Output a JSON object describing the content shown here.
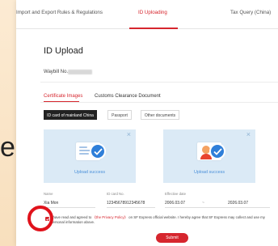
{
  "background": {
    "fragment": "e"
  },
  "tabs": [
    {
      "label": "Import and Export Rules & Regulations"
    },
    {
      "label": "ID Uploading"
    },
    {
      "label": "Tax Query (China)"
    }
  ],
  "page_title": "ID Upload",
  "waybill": {
    "label": "Waybill No."
  },
  "subtabs": [
    {
      "label": "Certificate Images"
    },
    {
      "label": "Customs Clearance Document"
    }
  ],
  "doc_types": [
    {
      "label": "ID card of mainland China"
    },
    {
      "label": "Passport"
    },
    {
      "label": "Other documents"
    }
  ],
  "uploads": [
    {
      "status": "Upload success",
      "close": "×"
    },
    {
      "status": "Upload success",
      "close": "×"
    }
  ],
  "fields": {
    "name": {
      "label": "Name",
      "value": "Xia Mon"
    },
    "id_card": {
      "label": "ID card No.",
      "value": "12345678912345678"
    },
    "effective": {
      "label": "Effective date",
      "start": "2006.03.07",
      "separator": "~",
      "end": "2026.03.07"
    }
  },
  "agreement": {
    "prefix": "I have read and agreed to ",
    "link": "《the Privacy Policy》",
    "suffix": " on SF Express official website. I hereby agree that SF Express may collect and use my personal information above."
  },
  "submit_label": "Submit",
  "colors": {
    "accent": "#d6262e",
    "upload_bg": "#dbeaf6",
    "success": "#2f7fd9"
  }
}
